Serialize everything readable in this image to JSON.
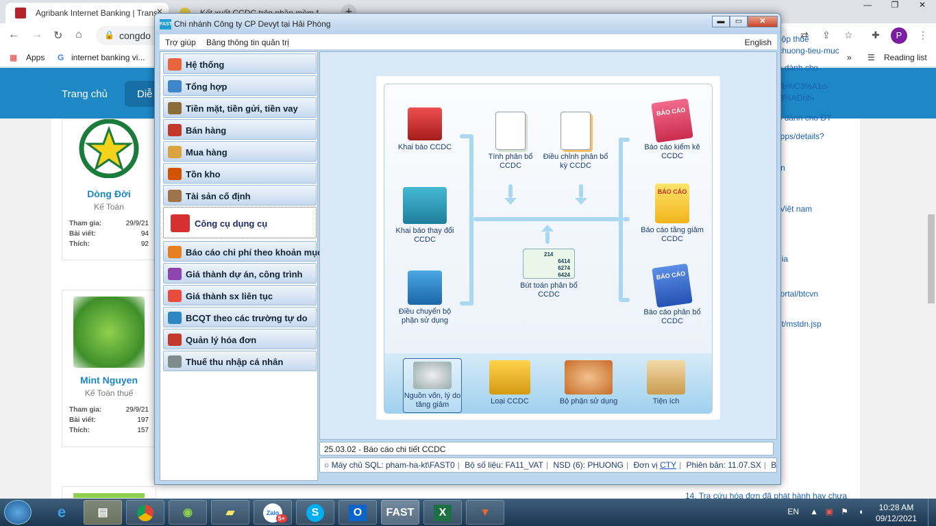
{
  "browser": {
    "tabs": [
      {
        "title": "Agribank Internet Banking | Trans"
      },
      {
        "title": "Kết xuất CCDC trên phần mềm f..."
      }
    ],
    "url": "congdo",
    "bookmarks": {
      "apps": "Apps",
      "item1": "internet banking vi...",
      "more": "»",
      "reading": "Reading list"
    },
    "profile_initial": "P",
    "colors": {
      "accent": "#1e88c7"
    }
  },
  "website": {
    "nav": [
      "Trang chủ",
      "Diễ"
    ],
    "users": [
      {
        "name": "Dòng Đời",
        "role": "Kế Toán",
        "join_label": "Tham gia:",
        "join": "29/9/21",
        "posts_label": "Bài viết:",
        "posts": "94",
        "likes_label": "Thích:",
        "likes": "92"
      },
      {
        "name": "Mint Nguyen",
        "role": "Kế Toán thuế",
        "join_label": "Tham gia:",
        "join": "29/9/21",
        "posts_label": "Bài viết:",
        "posts": "197",
        "likes_label": "Thích:",
        "likes": "157"
      }
    ],
    "right_links": [
      "ục nộp thuế",
      "na-chuong-tieu-muc",
      "hính dành cho",
      "",
      "app/b%C3%A1o-",
      "%C3%ADnh-",
      "",
      "hính dành cho ĐT",
      "",
      "re/apps/details?",
      "",
      "h",
      "ov.vn",
      "",
      "n",
      "",
      "XH Việt nam",
      "",
      "n",
      "n",
      "ốc gia",
      "",
      "",
      "er/portal/btcvn",
      "",
      "CN",
      "tcnnt/mstdn.jsp",
      "",
      "14. Tra cứu hóa đơn đã phát hành hay chưa"
    ]
  },
  "fast": {
    "title": "Chi nhánh Công ty CP Devyt tại Hải Phòng",
    "logo": "FAST",
    "menu": {
      "help": "Trợ giúp",
      "dashboard": "Bảng thông tin quản trị",
      "language": "English"
    },
    "modules": [
      {
        "label": "Hệ thống",
        "color": "#e8643a"
      },
      {
        "label": "Tổng hợp",
        "color": "#3f86c9"
      },
      {
        "label": "Tiền mặt, tiền gửi, tiền vay",
        "color": "#8a6d3b"
      },
      {
        "label": "Bán hàng",
        "color": "#c0392b"
      },
      {
        "label": "Mua hàng",
        "color": "#d9a441"
      },
      {
        "label": "Tồn kho",
        "color": "#d35400"
      },
      {
        "label": "Tài sản cố định",
        "color": "#a0744b"
      },
      {
        "label": "Công cụ dụng cụ",
        "color": "#d63031",
        "active": true
      },
      {
        "label": "Báo cáo chi phí theo khoản mục",
        "color": "#e67e22"
      },
      {
        "label": "Giá thành dự án, công trình",
        "color": "#8e44ad"
      },
      {
        "label": "Giá thành sx liên tục",
        "color": "#e74c3c"
      },
      {
        "label": "BCQT theo các trường tự do",
        "color": "#2e86c1"
      },
      {
        "label": "Quản lý hóa đơn",
        "color": "#c0392b"
      },
      {
        "label": "Thuế thu nhập cá nhân",
        "color": "#7f8c8d"
      }
    ],
    "flow": {
      "khai_bao": "Khai báo CCDC",
      "tinh_phan_bo": "Tính phân bổ CCDC",
      "dieu_chinh": "Điều chỉnh phân bổ kỳ CCDC",
      "khai_bao_thay_doi": "Khai báo thay đổi CCDC",
      "dieu_chuyen": "Điều chuyển bộ phận sử dụng",
      "but_toan": "Bút toán phân bổ CCDC",
      "but_toan_nums": [
        "214",
        "6414",
        "6274",
        "6424"
      ],
      "bao_cao_kiem_ke": "Báo cáo kiểm kê CCDC",
      "bao_cao_tang_giam": "Báo cáo tăng giảm CCDC",
      "bao_cao_phan_bo": "Báo cáo phân bổ CCDC",
      "bao_cao_stamp": "BÁO CÁO",
      "bottom": [
        "Nguồn vốn, lý do tăng giảm",
        "Loại CCDC",
        "Bộ phận sử dụng",
        "Tiện ích"
      ]
    },
    "status_line": "25.03.02 - Báo cáo chi tiết CCDC",
    "status_bar": {
      "server": "Máy chủ SQL: pham-ha-kt\\FAST0",
      "dataset": "Bộ số liệu: FA11_VAT",
      "user": "NSD (6): PHUONG",
      "unit_label": "Đơn vị",
      "unit": "CTY",
      "version": "Phiên bản: 11.07.SX",
      "copy": "Bản cậ"
    }
  },
  "taskbar": {
    "apps": [
      "FAST"
    ],
    "lang": "EN",
    "time": "10:28 AM",
    "date": "09/12/2021",
    "zalo_badge": "5+"
  }
}
